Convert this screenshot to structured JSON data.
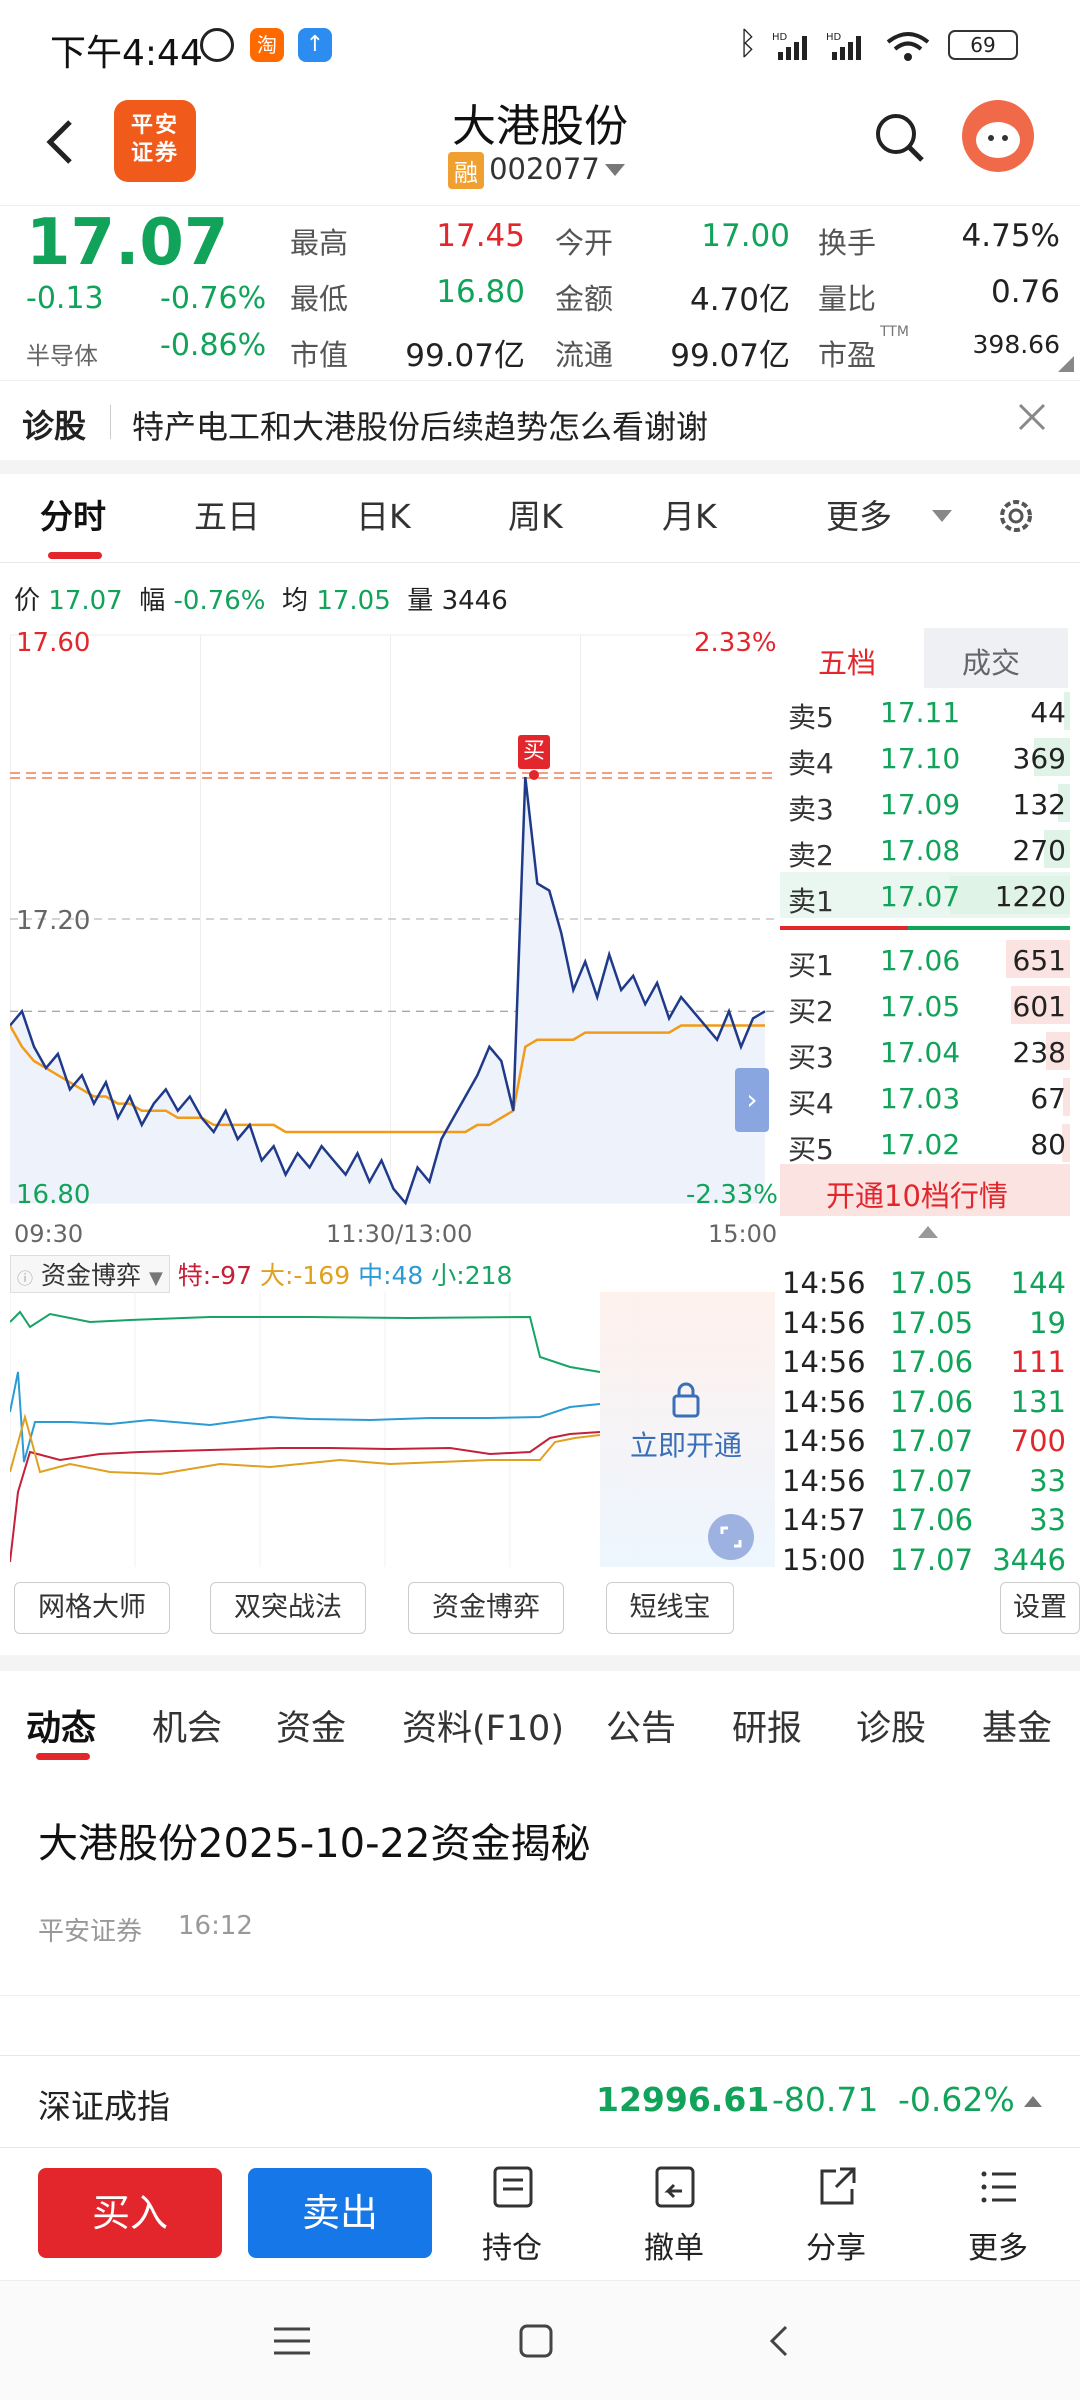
{
  "status": {
    "time": "下午4:44",
    "battery": "69",
    "hd1": "HD",
    "hd2": "HD"
  },
  "header": {
    "logo_text": "平安证券",
    "stock_name": "大港股份",
    "margin_tag": "融",
    "stock_code": "002077"
  },
  "quote": {
    "price": "17.07",
    "change": "-0.13",
    "change_pct": "-0.76%",
    "sector": "半导体",
    "sector_pct": "-0.86%",
    "cells": [
      {
        "label": "最高",
        "value": "17.45",
        "color": "#e3262c"
      },
      {
        "label": "今开",
        "value": "17.00",
        "color": "#11a35a"
      },
      {
        "label": "换手",
        "value": "4.75%",
        "color": "#222222"
      },
      {
        "label": "最低",
        "value": "16.80",
        "color": "#11a35a"
      },
      {
        "label": "金额",
        "value": "4.70亿",
        "color": "#222222"
      },
      {
        "label": "量比",
        "value": "0.76",
        "color": "#222222"
      },
      {
        "label": "市值",
        "value": "99.07亿",
        "color": "#222222"
      },
      {
        "label": "流通",
        "value": "99.07亿",
        "color": "#222222"
      },
      {
        "label": "市盈",
        "value": "398.66",
        "color": "#222222",
        "sup": "TTM"
      }
    ]
  },
  "diagnosis": {
    "label": "诊股",
    "text": "特产电工和大港股份后续趋势怎么看谢谢"
  },
  "chart_tabs": [
    "分时",
    "五日",
    "日K",
    "周K",
    "月K",
    "更多"
  ],
  "info_line": {
    "price_label": "价",
    "price": "17.07",
    "amp_label": "幅",
    "amp": "-0.76%",
    "avg_label": "均",
    "avg": "17.05",
    "vol_label": "量",
    "vol": "3446"
  },
  "chart_data": {
    "type": "line",
    "y_high": "17.60",
    "y_mid": "17.20",
    "y_low": "16.80",
    "pct_high": "2.33%",
    "pct_low": "-2.33%",
    "x_labels": [
      "09:30",
      "11:30/13:00",
      "15:00"
    ],
    "ylim": [
      16.8,
      17.6
    ],
    "buy_marker": "买",
    "series": [
      {
        "color": "#1f3a8a",
        "values": [
          17.05,
          17.07,
          17.02,
          16.99,
          17.01,
          16.96,
          16.98,
          16.94,
          16.97,
          16.92,
          16.95,
          16.91,
          16.94,
          16.96,
          16.93,
          16.95,
          16.92,
          16.9,
          16.93,
          16.89,
          16.91,
          16.86,
          16.88,
          16.84,
          16.87,
          16.85,
          16.88,
          16.86,
          16.84,
          16.87,
          16.83,
          16.86,
          16.82,
          16.8,
          16.85,
          16.83,
          16.89,
          16.92,
          16.95,
          16.98,
          17.02,
          17.0,
          16.93,
          17.4,
          17.25,
          17.24,
          17.18,
          17.1,
          17.14,
          17.09,
          17.15,
          17.1,
          17.12,
          17.08,
          17.11,
          17.06,
          17.09,
          17.07,
          17.05,
          17.03,
          17.07,
          17.02,
          17.06,
          17.07
        ]
      },
      {
        "color": "#f29b18",
        "values": [
          17.05,
          17.02,
          17.0,
          16.99,
          16.98,
          16.97,
          16.96,
          16.95,
          16.95,
          16.94,
          16.94,
          16.93,
          16.93,
          16.93,
          16.92,
          16.92,
          16.92,
          16.91,
          16.91,
          16.91,
          16.91,
          16.91,
          16.91,
          16.9,
          16.9,
          16.9,
          16.9,
          16.9,
          16.9,
          16.9,
          16.9,
          16.9,
          16.9,
          16.9,
          16.9,
          16.9,
          16.9,
          16.9,
          16.9,
          16.91,
          16.91,
          16.92,
          16.93,
          17.02,
          17.03,
          17.03,
          17.03,
          17.03,
          17.04,
          17.04,
          17.04,
          17.04,
          17.04,
          17.04,
          17.04,
          17.04,
          17.05,
          17.05,
          17.05,
          17.05,
          17.05,
          17.05,
          17.05,
          17.05
        ]
      }
    ]
  },
  "orderbook": {
    "tab_active": "五档",
    "tab_other": "成交",
    "asks": [
      {
        "label": "卖5",
        "price": "17.11",
        "vol": "44",
        "bar": 0.05
      },
      {
        "label": "卖4",
        "price": "17.10",
        "vol": "369",
        "bar": 0.3
      },
      {
        "label": "卖3",
        "price": "17.09",
        "vol": "132",
        "bar": 0.1
      },
      {
        "label": "卖2",
        "price": "17.08",
        "vol": "270",
        "bar": 0.22
      },
      {
        "label": "卖1",
        "price": "17.07",
        "vol": "1220",
        "bar": 1.0
      }
    ],
    "bids": [
      {
        "label": "买1",
        "price": "17.06",
        "vol": "651",
        "bar": 0.53
      },
      {
        "label": "买2",
        "price": "17.05",
        "vol": "601",
        "bar": 0.49
      },
      {
        "label": "买3",
        "price": "17.04",
        "vol": "238",
        "bar": 0.2
      },
      {
        "label": "买4",
        "price": "17.03",
        "vol": "67",
        "bar": 0.06
      },
      {
        "label": "买5",
        "price": "17.02",
        "vol": "80",
        "bar": 0.07
      }
    ],
    "upgrade": "开通10档行情"
  },
  "trades": [
    {
      "time": "14:56",
      "price": "17.05",
      "vol": "144",
      "color": "#11a35a"
    },
    {
      "time": "14:56",
      "price": "17.05",
      "vol": "19",
      "color": "#11a35a"
    },
    {
      "time": "14:56",
      "price": "17.06",
      "vol": "111",
      "color": "#e3262c"
    },
    {
      "time": "14:56",
      "price": "17.06",
      "vol": "131",
      "color": "#11a35a"
    },
    {
      "time": "14:56",
      "price": "17.07",
      "vol": "700",
      "color": "#e3262c"
    },
    {
      "time": "14:56",
      "price": "17.07",
      "vol": "33",
      "color": "#11a35a"
    },
    {
      "time": "14:57",
      "price": "17.06",
      "vol": "33",
      "color": "#11a35a"
    },
    {
      "time": "15:00",
      "price": "17.07",
      "vol": "3446",
      "color": "#11a35a"
    }
  ],
  "capital": {
    "title": "资金博弈",
    "special": "特:-97",
    "large": "大:-169",
    "medium": "中:48",
    "small": "小:218",
    "unlock": "立即开通"
  },
  "tools": [
    "网格大师",
    "双突战法",
    "资金博弈",
    "短线宝"
  ],
  "settings": "设置",
  "sub_tabs": [
    "动态",
    "机会",
    "资金",
    "资料(F10)",
    "公告",
    "研报",
    "诊股",
    "基金"
  ],
  "news": {
    "title": "大港股份2025-10-22资金揭秘",
    "source": "平安证券",
    "time": "16:12"
  },
  "index": {
    "name": "深证成指",
    "value": "12996.61",
    "change": "-80.71",
    "change_pct": "-0.62%"
  },
  "actions": {
    "buy": "买入",
    "sell": "卖出",
    "holdings": "持仓",
    "cancel": "撤单",
    "share": "分享",
    "more": "更多"
  }
}
